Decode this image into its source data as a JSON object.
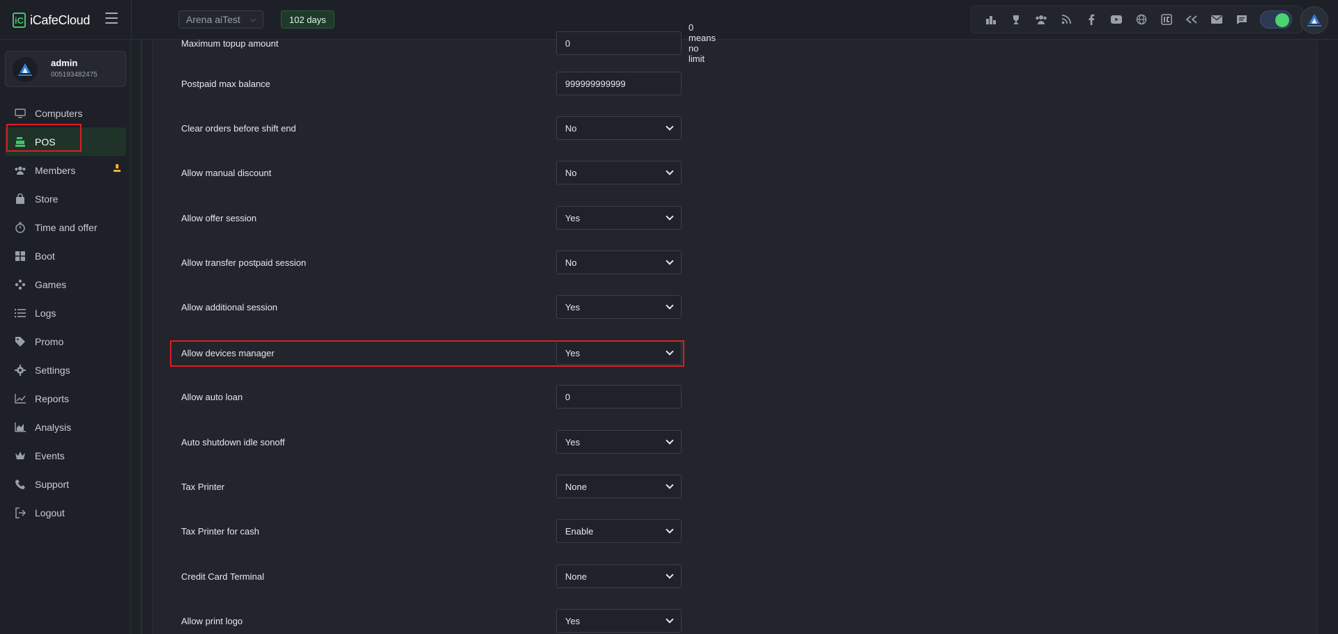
{
  "app": {
    "logo_mark": "iC",
    "logo_text": "iCafeCloud",
    "center_select": "Arena aiTest",
    "days_badge": "102 days"
  },
  "top_icons": [
    "leaderboard-icon",
    "trophy-icon",
    "users-group-icon",
    "rss-icon",
    "facebook-icon",
    "youtube-icon",
    "globe-icon",
    "icafe-icon",
    "chevrons-icon",
    "mail-icon",
    "chat-icon"
  ],
  "user": {
    "name": "admin",
    "id": "005193482475"
  },
  "nav": [
    {
      "label": "Computers",
      "icon": "monitor-icon"
    },
    {
      "label": "POS",
      "icon": "cash-register-icon",
      "active": true
    },
    {
      "label": "Members",
      "icon": "members-icon"
    },
    {
      "label": "Store",
      "icon": "bag-icon"
    },
    {
      "label": "Time and offer",
      "icon": "stopwatch-icon"
    },
    {
      "label": "Boot",
      "icon": "windows-icon"
    },
    {
      "label": "Games",
      "icon": "gamepad-icon"
    },
    {
      "label": "Logs",
      "icon": "list-icon"
    },
    {
      "label": "Promo",
      "icon": "tag-icon"
    },
    {
      "label": "Settings",
      "icon": "gear-icon"
    },
    {
      "label": "Reports",
      "icon": "chart-line-icon"
    },
    {
      "label": "Analysis",
      "icon": "chart-area-icon"
    },
    {
      "label": "Events",
      "icon": "crown-icon"
    },
    {
      "label": "Support",
      "icon": "phone-icon"
    },
    {
      "label": "Logout",
      "icon": "logout-icon"
    }
  ],
  "settings": [
    {
      "label": "Maximum topup amount",
      "value": "0",
      "type": "input",
      "hint": "0 means no limit"
    },
    {
      "label": "Postpaid max balance",
      "value": "999999999999",
      "type": "input"
    },
    {
      "label": "Clear orders before shift end",
      "value": "No",
      "type": "select"
    },
    {
      "label": "Allow manual discount",
      "value": "No",
      "type": "select"
    },
    {
      "label": "Allow offer session",
      "value": "Yes",
      "type": "select"
    },
    {
      "label": "Allow transfer postpaid session",
      "value": "No",
      "type": "select"
    },
    {
      "label": "Allow additional session",
      "value": "Yes",
      "type": "select"
    },
    {
      "label": "Allow devices manager",
      "value": "Yes",
      "type": "select"
    },
    {
      "label": "Allow auto loan",
      "value": "0",
      "type": "input"
    },
    {
      "label": "Auto shutdown idle sonoff",
      "value": "Yes",
      "type": "select"
    },
    {
      "label": "Tax Printer",
      "value": "None",
      "type": "select"
    },
    {
      "label": "Tax Printer for cash",
      "value": "Enable",
      "type": "select"
    },
    {
      "label": "Credit Card Terminal",
      "value": "None",
      "type": "select"
    },
    {
      "label": "Allow print logo",
      "value": "Yes",
      "type": "select"
    }
  ]
}
